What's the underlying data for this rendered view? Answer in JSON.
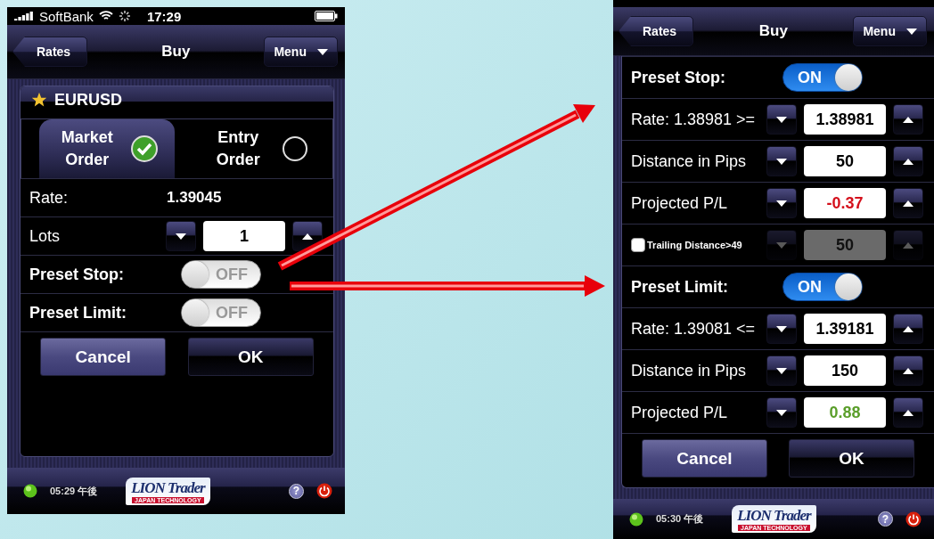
{
  "screens": [
    {
      "status_bar": {
        "carrier": "SoftBank",
        "time": "17:29"
      },
      "nav": {
        "back": "Rates",
        "title": "Buy",
        "menu": "Menu"
      },
      "symbol": "EURUSD",
      "order_types": [
        {
          "label": "Market Order",
          "selected": true
        },
        {
          "label": "Entry Order",
          "selected": false
        }
      ],
      "rows": [
        {
          "kind": "readout",
          "label": "Rate:",
          "value": "1.39045"
        },
        {
          "kind": "stepper",
          "label": "Lots",
          "value": "1"
        },
        {
          "kind": "toggle",
          "label": "Preset Stop:",
          "on": false,
          "state_text": "OFF"
        },
        {
          "kind": "toggle",
          "label": "Preset Limit:",
          "on": false,
          "state_text": "OFF"
        }
      ],
      "buttons": [
        "Cancel",
        "OK"
      ],
      "footer": {
        "time": "05:29 午後",
        "logo": "LION Trader",
        "logo_tagline": "JAPAN TECHNOLOGY",
        "help": "?"
      }
    },
    {
      "nav": {
        "back": "Rates",
        "title": "Buy",
        "menu": "Menu"
      },
      "rows": [
        {
          "kind": "toggle",
          "label": "Preset Stop:",
          "on": true,
          "state_text": "ON"
        },
        {
          "kind": "stepper",
          "label": "Rate: 1.38981 >=",
          "value": "1.38981"
        },
        {
          "kind": "stepper",
          "label": "Distance in Pips",
          "value": "50"
        },
        {
          "kind": "stepper",
          "label": "Projected P/L",
          "value": "-0.37",
          "color": "#d4101c"
        },
        {
          "kind": "check_stepper",
          "label": "Trailing Distance>49",
          "value": "50",
          "checked": false,
          "disabled": true
        },
        {
          "kind": "toggle",
          "label": "Preset Limit:",
          "on": true,
          "state_text": "ON"
        },
        {
          "kind": "stepper",
          "label": "Rate: 1.39081 <=",
          "value": "1.39181"
        },
        {
          "kind": "stepper",
          "label": "Distance in Pips",
          "value": "150"
        },
        {
          "kind": "stepper",
          "label": "Projected P/L",
          "value": "0.88",
          "color": "#5a9e2a"
        }
      ],
      "buttons": [
        "Cancel",
        "OK"
      ],
      "footer": {
        "time": "05:30 午後",
        "logo": "LION Trader",
        "logo_tagline": "JAPAN TECHNOLOGY",
        "help": "?"
      }
    }
  ]
}
